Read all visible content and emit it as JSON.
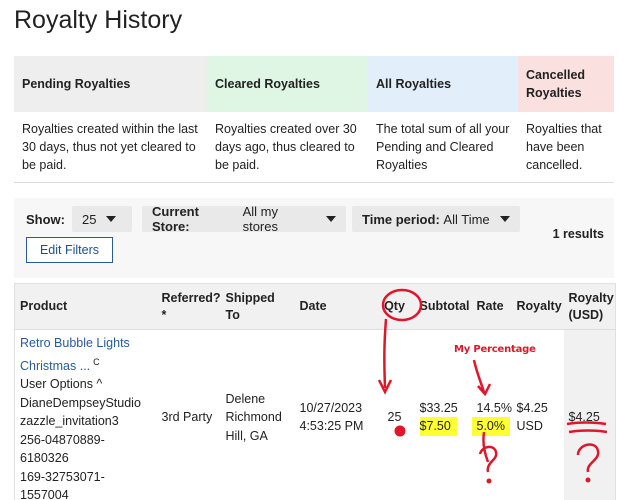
{
  "page": {
    "title": "Royalty History"
  },
  "status_columns": [
    {
      "header": "Pending Royalties",
      "description": "Royalties created within the last 30 days, thus not yet cleared to be paid."
    },
    {
      "header": "Cleared Royalties",
      "description": "Royalties created over 30 days ago, thus cleared to be paid."
    },
    {
      "header": "All Royalties",
      "description": "The total sum of all your Pending and Cleared Royalties"
    },
    {
      "header": "Cancelled Royalties",
      "description": "Royalties that have been cancelled."
    }
  ],
  "filters": {
    "show_label": "Show:",
    "show_value": "25",
    "store_label": "Current Store:",
    "store_value": "All my stores",
    "period_label": "Time period:",
    "period_value": "All Time",
    "edit_button": "Edit Filters",
    "results": "1 results"
  },
  "table": {
    "headers": {
      "product": "Product",
      "referred": "Referred? *",
      "shipped_to": "Shipped To",
      "date": "Date",
      "qty": "Qty",
      "subtotal": "Subtotal",
      "rate": "Rate",
      "royalty": "Royalty",
      "royalty_usd": "Royalty (USD)"
    },
    "rows": [
      {
        "product_link": "Retro Bubble Lights Christmas ...",
        "product_link_suffix": "C",
        "product_options": "User Options ^",
        "product_store": "DianeDempseyStudio",
        "product_template": "zazzle_invitation3",
        "product_id": "256-04870889-6180326",
        "order_id": "169-32753071-1557004",
        "referred": "3rd Party",
        "shipped_to": "Delene Richmond Hill, GA",
        "date": "10/27/2023",
        "time": "4:53:25 PM",
        "qty": "25",
        "subtotal": "$33.25",
        "subtotal_highlight": "$7.50",
        "rate": "14.5%",
        "rate_highlight": "5.0%",
        "royalty": "$4.25 USD",
        "royalty_usd": "$4.25"
      }
    ]
  },
  "annotations": {
    "label": "My Percentage",
    "color": "#e0162b",
    "highlight_color": "#ffff33"
  }
}
